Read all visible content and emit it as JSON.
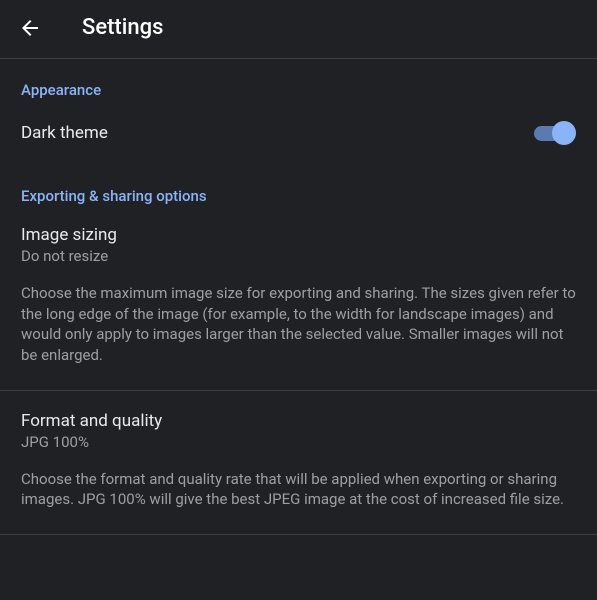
{
  "header": {
    "title": "Settings"
  },
  "sections": {
    "appearance": {
      "header": "Appearance",
      "dark_theme": {
        "label": "Dark theme",
        "enabled": true
      }
    },
    "exporting": {
      "header": "Exporting & sharing options",
      "image_sizing": {
        "title": "Image sizing",
        "value": "Do not resize",
        "description": "Choose the maximum image size for exporting and sharing. The sizes given refer to the long edge of the image (for example, to the width for landscape images) and would only apply to images larger than the selected value. Smaller images will not be enlarged."
      },
      "format_quality": {
        "title": "Format and quality",
        "value": "JPG 100%",
        "description": "Choose the format and quality rate that will be applied when exporting or sharing images. JPG 100% will give the best JPEG image at the cost of increased file size."
      }
    }
  }
}
